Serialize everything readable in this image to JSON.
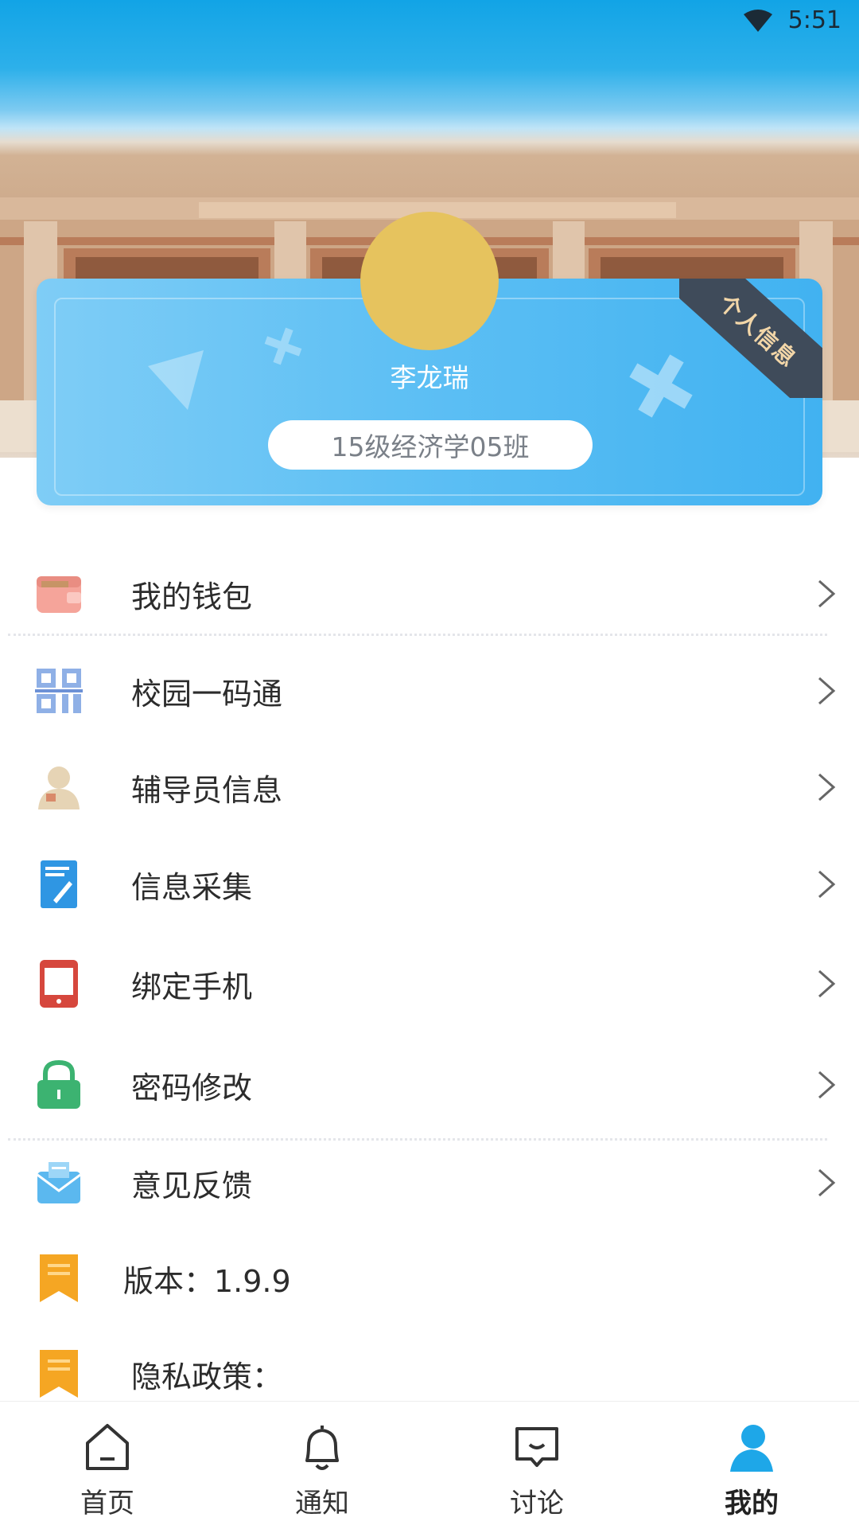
{
  "status_bar": {
    "time": "5:51"
  },
  "profile": {
    "badge_label": "个人信息",
    "name": "李龙瑞",
    "class_name": "15级经济学05班"
  },
  "menu": [
    {
      "label": "我的钱包",
      "icon": "wallet-icon"
    },
    {
      "label": "校园一码通",
      "icon": "qr-code-icon"
    },
    {
      "label": "辅导员信息",
      "icon": "person-icon"
    },
    {
      "label": "信息采集",
      "icon": "notebook-icon"
    },
    {
      "label": "绑定手机",
      "icon": "phone-icon"
    },
    {
      "label": "密码修改",
      "icon": "lock-icon"
    },
    {
      "label": "意见反馈",
      "icon": "mail-icon"
    },
    {
      "label": "版本：1.9.9",
      "icon": "bookmark-icon"
    },
    {
      "label": "隐私政策：",
      "icon": "bookmark-icon"
    }
  ],
  "tabs": [
    {
      "label": "首页",
      "icon": "home-icon"
    },
    {
      "label": "通知",
      "icon": "bell-icon"
    },
    {
      "label": "讨论",
      "icon": "chat-icon"
    },
    {
      "label": "我的",
      "icon": "user-icon",
      "active": true
    }
  ],
  "colors": {
    "accent": "#1ea7e8",
    "card": "#4fb9f2",
    "avatar": "#e6c35e"
  }
}
